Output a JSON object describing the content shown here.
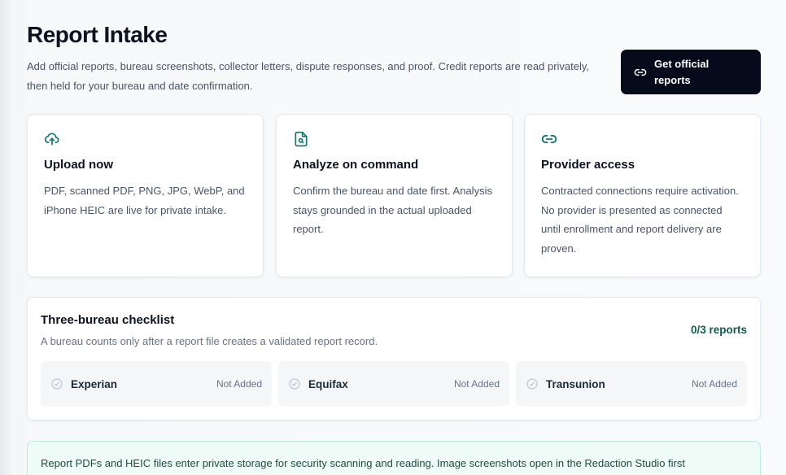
{
  "header": {
    "title": "Report Intake",
    "subtitle": "Add official reports, bureau screenshots, collector letters, dispute responses, and proof. Credit reports are read privately, then held for your bureau and date confirmation.",
    "cta_label": "Get official reports",
    "cta_icon": "link-icon"
  },
  "cards": [
    {
      "icon": "cloud-upload-icon",
      "title": "Upload now",
      "body": "PDF, scanned PDF, PNG, JPG, WebP, and iPhone HEIC are live for private intake."
    },
    {
      "icon": "document-search-icon",
      "title": "Analyze on command",
      "body": "Confirm the bureau and date first. Analysis stays grounded in the actual uploaded report."
    },
    {
      "icon": "link-icon",
      "title": "Provider access",
      "body": "Contracted connections require activation. No provider is presented as connected until enrollment and report delivery are proven."
    }
  ],
  "checklist": {
    "title": "Three-bureau checklist",
    "description": "A bureau counts only after a report file creates a validated report record.",
    "count": "0/3 reports",
    "bureaus": [
      {
        "name": "Experian",
        "status": "Not Added",
        "icon": "check-circle-icon"
      },
      {
        "name": "Equifax",
        "status": "Not Added",
        "icon": "check-circle-icon"
      },
      {
        "name": "Transunion",
        "status": "Not Added",
        "icon": "check-circle-icon"
      }
    ]
  },
  "notice": {
    "text": "Report PDFs and HEIC files enter private storage for security scanning and reading. Image screenshots open in the Redaction Studio first"
  },
  "colors": {
    "accent": "#0f766e",
    "cta_background": "#050b1a",
    "notice_background": "#effbf7",
    "notice_border": "#b9ece0"
  }
}
